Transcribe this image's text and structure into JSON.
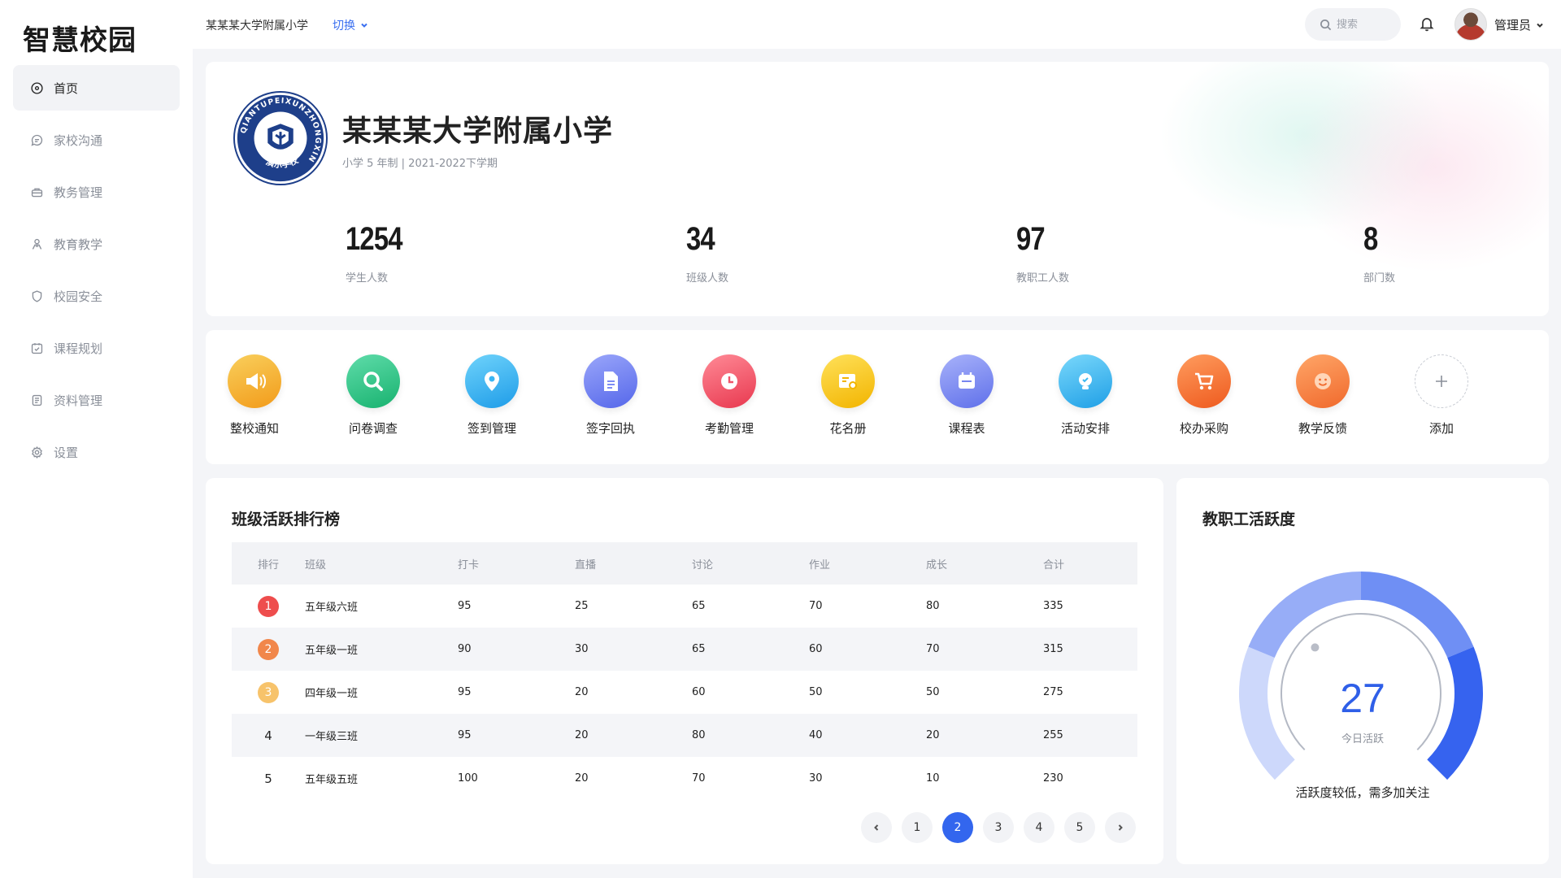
{
  "app": {
    "brand": "智慧校园"
  },
  "sidebar": {
    "items": [
      {
        "label": "首页",
        "icon": "home-icon",
        "active": true
      },
      {
        "label": "家校沟通",
        "icon": "chat-icon"
      },
      {
        "label": "教务管理",
        "icon": "briefcase-icon"
      },
      {
        "label": "教育教学",
        "icon": "teaching-icon"
      },
      {
        "label": "校园安全",
        "icon": "shield-icon"
      },
      {
        "label": "课程规划",
        "icon": "calendar-check-icon"
      },
      {
        "label": "资料管理",
        "icon": "document-icon"
      },
      {
        "label": "设置",
        "icon": "gear-icon"
      }
    ]
  },
  "topbar": {
    "school": "某某某大学附属小学",
    "switch_label": "切换",
    "search_placeholder": "搜索",
    "admin_label": "管理员"
  },
  "hero": {
    "title": "某某某大学附属小学",
    "subtitle": "小学 5 年制 | 2021-2022下学期",
    "logo_ring_text": "QIANTUPEIXUNZHONGXIN",
    "logo_bottom_text": "演示学校",
    "stats": [
      {
        "value": "1254",
        "label": "学生人数"
      },
      {
        "value": "34",
        "label": "班级人数"
      },
      {
        "value": "97",
        "label": "教职工人数"
      },
      {
        "value": "8",
        "label": "部门数"
      }
    ]
  },
  "apps": [
    {
      "label": "整校通知",
      "icon": "megaphone-icon",
      "color": "#f5b52e"
    },
    {
      "label": "问卷调查",
      "icon": "search-icon",
      "color": "#2fc68a"
    },
    {
      "label": "签到管理",
      "icon": "location-pin-icon",
      "color": "#35b6f2"
    },
    {
      "label": "签字回执",
      "icon": "file-icon",
      "color": "#6b7cf2"
    },
    {
      "label": "考勤管理",
      "icon": "clock-icon",
      "color": "#f0556a"
    },
    {
      "label": "花名册",
      "icon": "roster-icon",
      "color": "#f7c21c"
    },
    {
      "label": "课程表",
      "icon": "calendar-icon",
      "color": "#7786f0"
    },
    {
      "label": "活动安排",
      "icon": "lightbulb-icon",
      "color": "#3cb7f0"
    },
    {
      "label": "校办采购",
      "icon": "cart-icon",
      "color": "#f4733a"
    },
    {
      "label": "教学反馈",
      "icon": "smile-icon",
      "color": "#f68a3c"
    },
    {
      "label": "添加",
      "icon": "plus-icon",
      "color": "#c8ccd3"
    }
  ],
  "ranking": {
    "title": "班级活跃排行榜",
    "headers": [
      "排行",
      "班级",
      "打卡",
      "直播",
      "讨论",
      "作业",
      "成长",
      "合计"
    ],
    "rows": [
      [
        "1",
        "五年级六班",
        "95",
        "25",
        "65",
        "70",
        "80",
        "335"
      ],
      [
        "2",
        "五年级一班",
        "90",
        "30",
        "65",
        "60",
        "70",
        "315"
      ],
      [
        "3",
        "四年级一班",
        "95",
        "20",
        "60",
        "50",
        "50",
        "275"
      ],
      [
        "4",
        "一年级三班",
        "95",
        "20",
        "80",
        "40",
        "20",
        "255"
      ],
      [
        "5",
        "五年级五班",
        "100",
        "20",
        "70",
        "30",
        "10",
        "230"
      ]
    ],
    "pages": [
      "1",
      "2",
      "3",
      "4",
      "5"
    ],
    "current_page": "2"
  },
  "activity": {
    "title": "教职工活跃度",
    "value": "27",
    "value_label": "今日活跃",
    "note": "活跃度较低，需多加关注",
    "colors": [
      "#cdd8fb",
      "#97adf7",
      "#6f8ff4",
      "#3663ef"
    ]
  }
}
